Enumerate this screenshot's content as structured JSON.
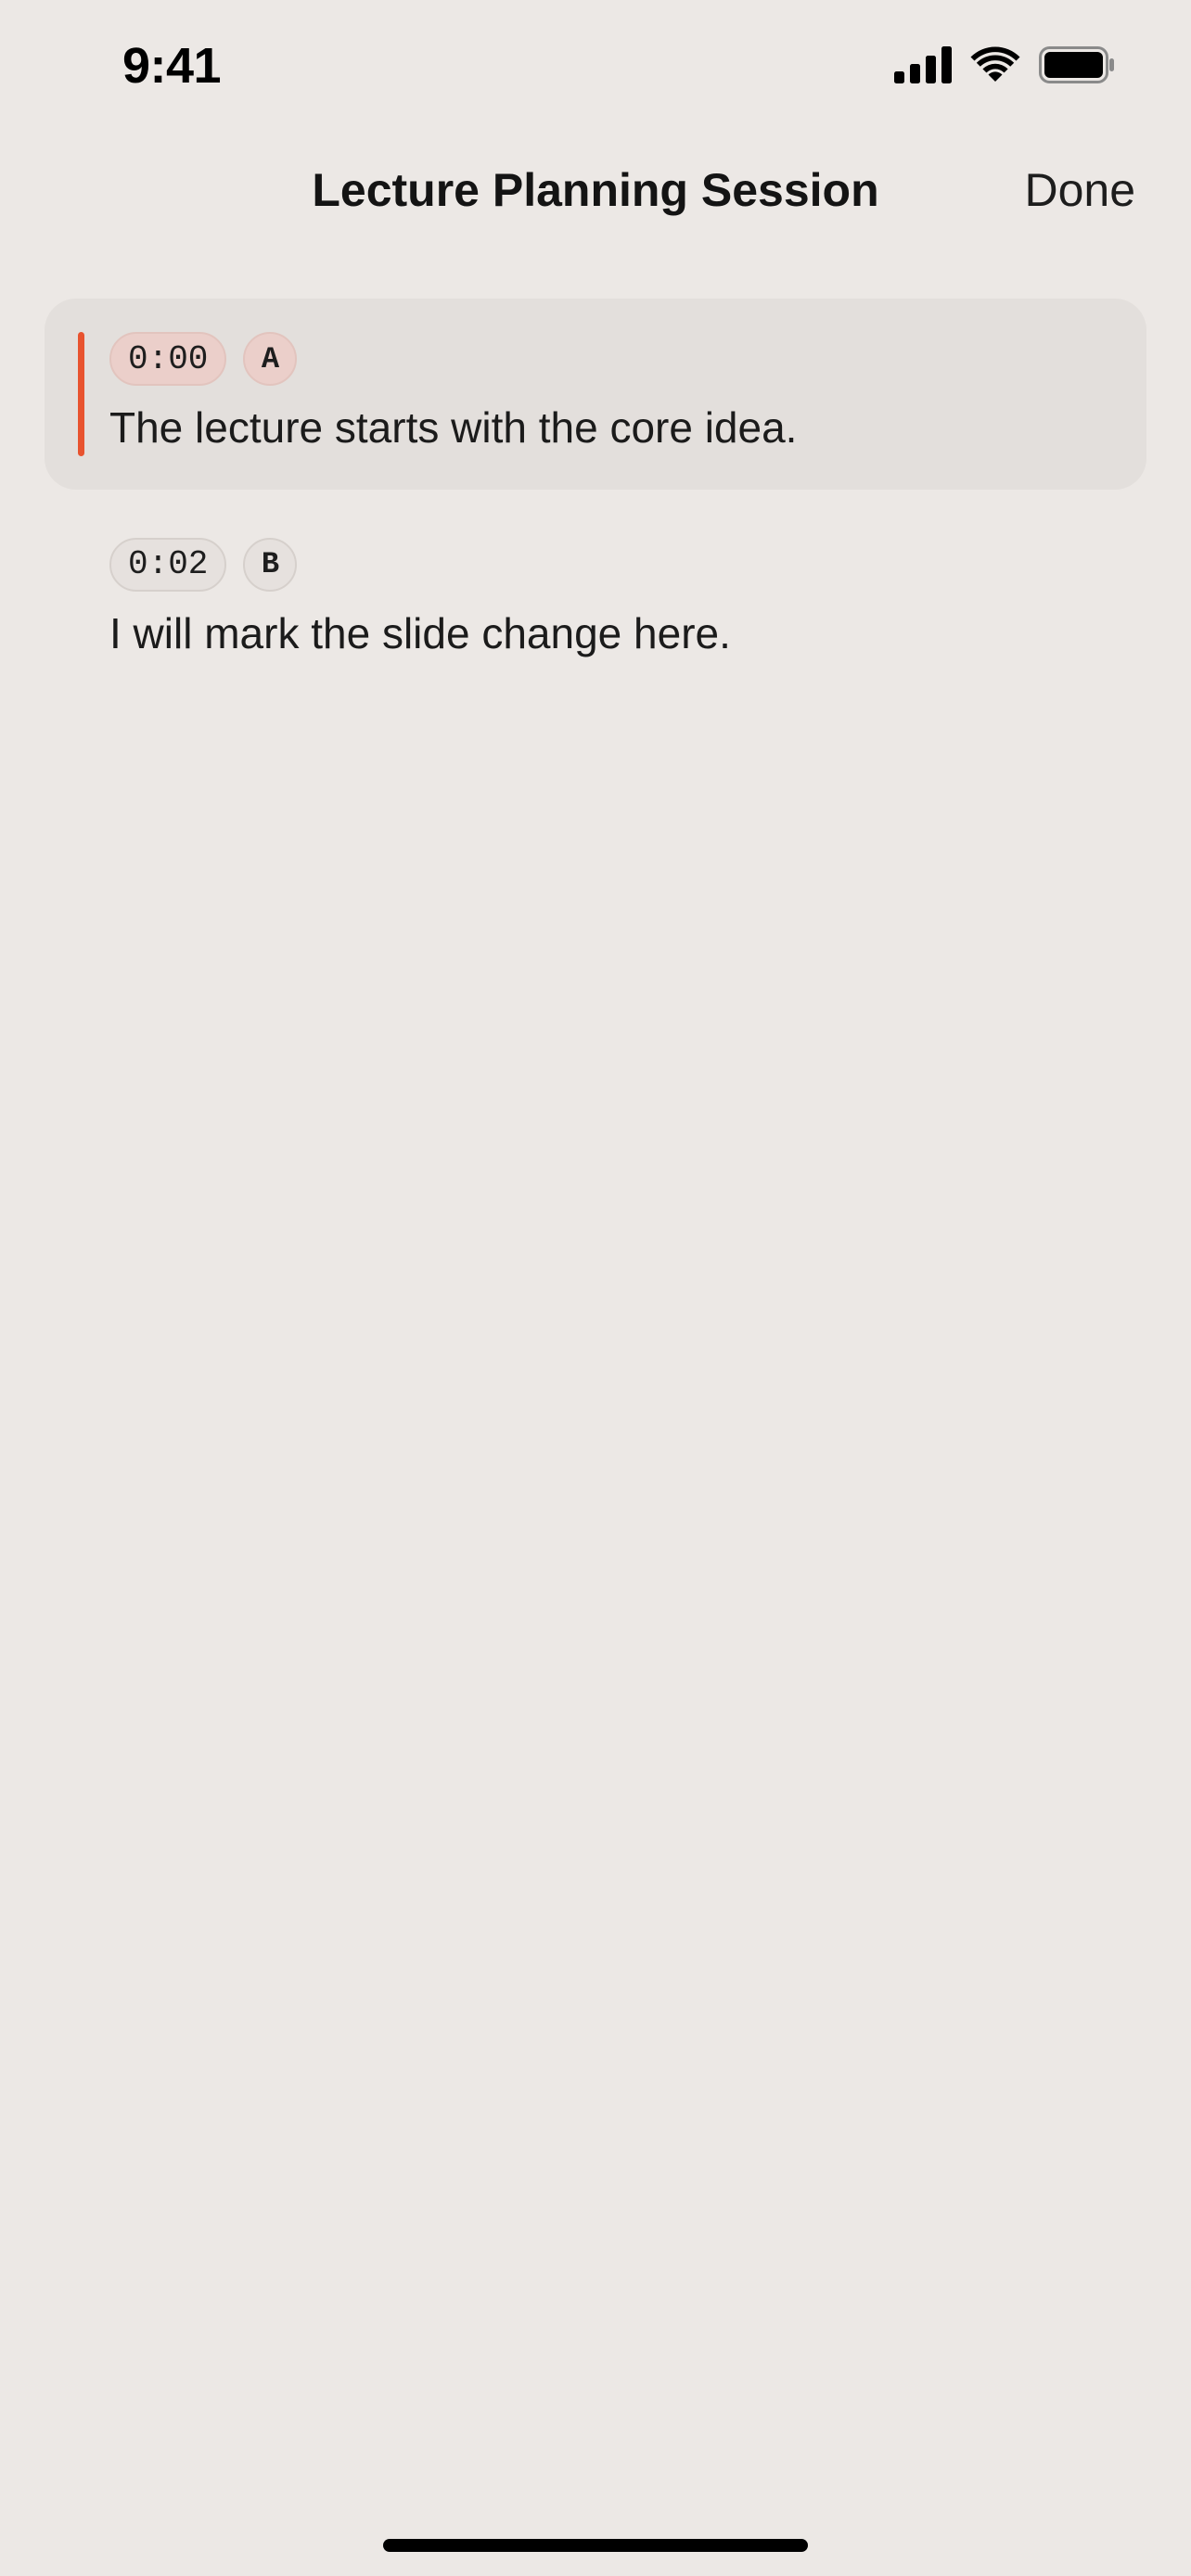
{
  "status_bar": {
    "time": "9:41",
    "icons": [
      "cellular-signal-icon",
      "wifi-icon",
      "battery-icon"
    ]
  },
  "nav": {
    "title": "Lecture Planning Session",
    "done_label": "Done"
  },
  "colors": {
    "background": "#ECE8E5",
    "active_segment_bg": "#E3DFDC",
    "active_accent": "#E8532F",
    "active_chip_bg": "#EBCFCA",
    "chip_bg": "#E6E1DE"
  },
  "segments": [
    {
      "time": "0:00",
      "speaker": "A",
      "text": "The lecture starts with the core idea.",
      "active": true
    },
    {
      "time": "0:02",
      "speaker": "B",
      "text": "I will mark the slide change here.",
      "active": false
    }
  ]
}
